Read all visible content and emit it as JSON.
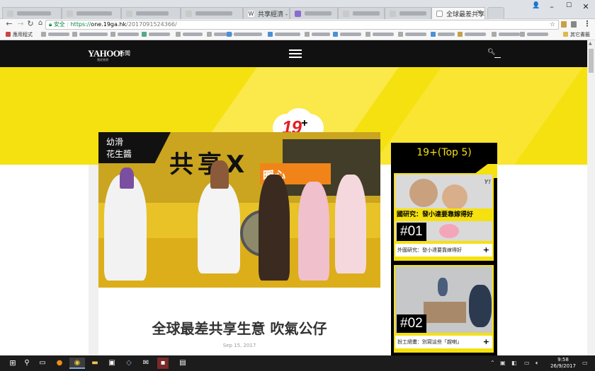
{
  "browser": {
    "tabs": [
      {
        "label": "",
        "fav": "#c9c9c9"
      },
      {
        "label": "",
        "fav": "#c9c9c9"
      },
      {
        "label": "",
        "fav": "#c9c9c9"
      },
      {
        "label": "",
        "fav": "#c9c9c9"
      },
      {
        "label": "共享經濟 - Wi",
        "fav": "#fff",
        "prefix": "W"
      },
      {
        "label": "",
        "fav": "#8a6ad0"
      },
      {
        "label": "",
        "fav": "#c9c9c9"
      },
      {
        "label": "",
        "fav": "#c9c9c9"
      },
      {
        "label": "全球最差共享",
        "fav": "#fff",
        "active": true
      }
    ],
    "secure_label": "安全",
    "url_scheme": "https://",
    "url_host": "one.19ga.hk",
    "url_path": "/2017091524366/",
    "bookmarks_label": "應用程式",
    "other_bookmarks": "其它書籤"
  },
  "site": {
    "brand": "YAHOO!",
    "brand_sub": "雅虎香港",
    "section": "新聞",
    "logo_num": "19",
    "logo_sup": "+"
  },
  "article": {
    "tag": "幼滑\n花生醬",
    "hero_sign": "共享X",
    "hero_orange": "暖心",
    "headline": "全球最差共享生意 吹氣公仔",
    "date": "Sep 15, 2017"
  },
  "sidebar": {
    "title": "19+(Top 5)",
    "items": [
      {
        "rank": "#01",
        "banner": "國研究：發小達要靠嫁得好",
        "caption": "外國研究：發小達要靠嫁得好",
        "plus": "+"
      },
      {
        "rank": "#02",
        "banner": "",
        "caption": "扮工絕畫：別寫這些「趕喇」",
        "plus": "+"
      }
    ]
  },
  "taskbar": {
    "time": "9:58",
    "date": "26/9/2017"
  },
  "colors": {
    "yellow": "#f5e10f",
    "header": "#111111",
    "logo_red": "#e51d23"
  }
}
